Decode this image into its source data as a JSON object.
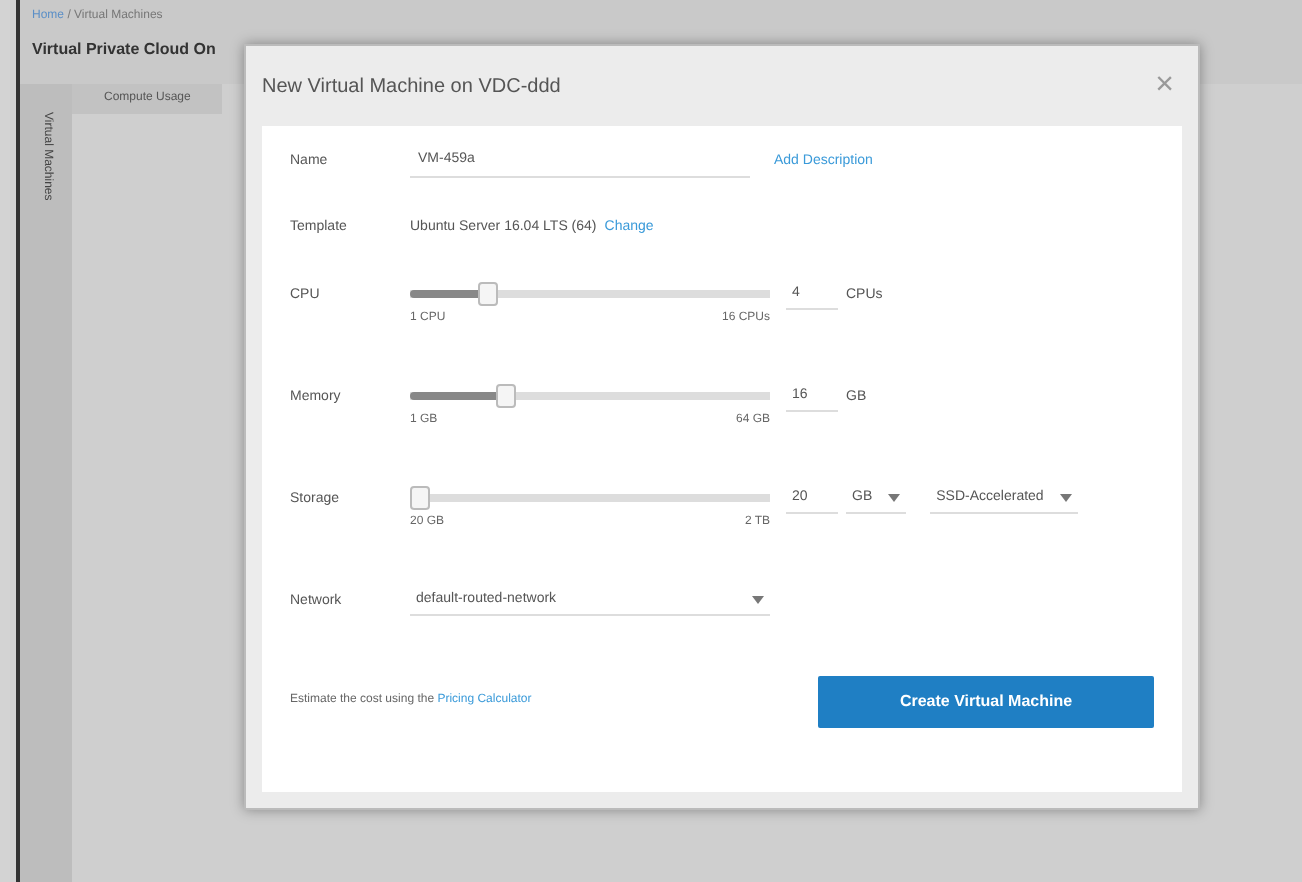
{
  "breadcrumb": [
    {
      "label": "Home",
      "link": true
    },
    {
      "label": "/",
      "link": false
    },
    {
      "label": "Virtual Machines",
      "link": false
    }
  ],
  "page_title": "Virtual Private Cloud On",
  "side_tab": "Virtual Machines",
  "panel_tab": "Compute Usage",
  "modal": {
    "title": "New Virtual Machine on VDC-ddd",
    "close": "×",
    "name": {
      "label": "Name",
      "value": "VM-459a",
      "link": "Add Description"
    },
    "template": {
      "label": "Template",
      "value": "Ubuntu Server 16.04 LTS (64)",
      "link": "Change"
    },
    "sliders": [
      {
        "label": "CPU",
        "level": 0.2,
        "min": "1 CPU",
        "max": "16 CPUs",
        "value": "4",
        "unit": "CPUs",
        "kind": "text"
      },
      {
        "label": "Memory",
        "level": 0.25,
        "min": "1 GB",
        "max": "64 GB",
        "value": "16",
        "unit": "GB",
        "kind": "text"
      },
      {
        "label": "Storage",
        "level": 0.0,
        "min": "20 GB",
        "max": "2 TB",
        "value": "20",
        "unit": "GB",
        "kind": "select",
        "tier": "SSD-Accelerated"
      }
    ],
    "network": {
      "label": "Network",
      "value": "default-routed-network"
    },
    "footer_text": "Estimate the cost using the ",
    "footer_link": "Pricing Calculator",
    "button": "Create Virtual Machine"
  }
}
